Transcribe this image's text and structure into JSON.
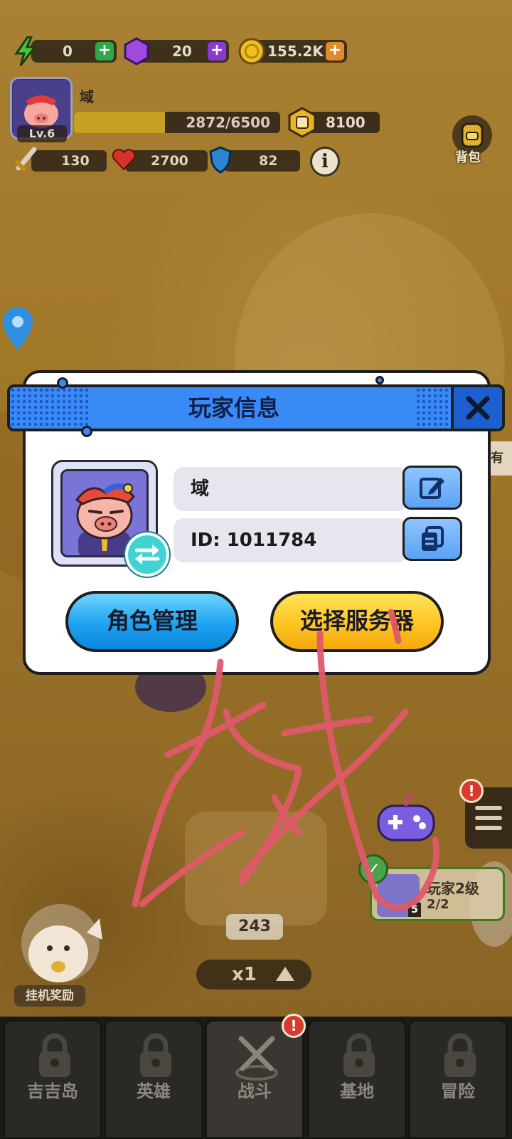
{
  "top_bar": {
    "energy": {
      "value": "0",
      "icon": "lightning-icon"
    },
    "gems": {
      "value": "20",
      "icon": "gem-icon"
    },
    "coins": {
      "value": "155.2K",
      "icon": "coin-icon"
    }
  },
  "player": {
    "name": "域",
    "level": "Lv.6",
    "xp_text": "2872/6500",
    "xp_fraction": 0.44,
    "power": "8100",
    "attack": "130",
    "hp": "2700",
    "defense": "82",
    "bag_label": "背包"
  },
  "dialog": {
    "title": "玩家信息",
    "name_value": "域",
    "id_value": "ID: 1011784",
    "role_button": "角色管理",
    "server_button": "选择服务器"
  },
  "scene": {
    "count": "243",
    "speed": "x1",
    "idle_reward": "挂机奖励",
    "task_title": "玩家2级",
    "task_progress": "2/2",
    "task_badge": "5",
    "side_text": "有机"
  },
  "nav": {
    "tabs": [
      {
        "label": "吉吉岛",
        "locked": true
      },
      {
        "label": "英雄",
        "locked": true
      },
      {
        "label": "战斗",
        "locked": false
      },
      {
        "label": "基地",
        "locked": true
      },
      {
        "label": "冒险",
        "locked": true
      }
    ],
    "alert": "!"
  },
  "colors": {
    "header_blue": "#3a8af5",
    "close_blue": "#1d5fd0",
    "role_button": "#1ea3f0",
    "server_button": "#ffc522",
    "handwriting": "#e05a6a"
  }
}
